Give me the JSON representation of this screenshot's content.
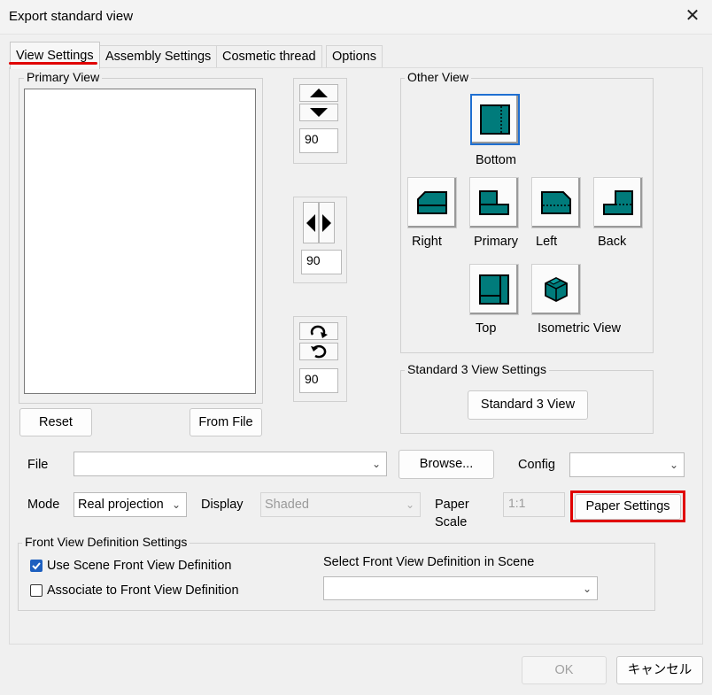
{
  "window": {
    "title": "Export standard view",
    "close_glyph": "✕"
  },
  "tabs": [
    {
      "label": "View Settings",
      "active": true
    },
    {
      "label": "Assembly Settings"
    },
    {
      "label": "Cosmetic thread"
    },
    {
      "label": "Options"
    }
  ],
  "primary_view": {
    "legend": "Primary View",
    "reset_label": "Reset",
    "from_file_label": "From File"
  },
  "rotation": {
    "vertical_value": "90",
    "horizontal_value": "90",
    "roll_value": "90"
  },
  "other_view": {
    "legend": "Other View",
    "bottom": "Bottom",
    "right": "Right",
    "primary": "Primary",
    "left": "Left",
    "back": "Back",
    "top": "Top",
    "isometric": "Isometric View"
  },
  "standard3": {
    "legend": "Standard 3 View Settings",
    "button_label": "Standard 3 View"
  },
  "file_row": {
    "file_label": "File",
    "file_value": "",
    "browse_label": "Browse...",
    "config_label": "Config",
    "config_value": ""
  },
  "mode_row": {
    "mode_label": "Mode",
    "mode_value": "Real projection",
    "display_label": "Display",
    "display_value": "Shaded",
    "paper_scale_label_1": "Paper",
    "paper_scale_label_2": "Scale",
    "paper_scale_value": "1:1",
    "paper_settings_label": "Paper Settings"
  },
  "front_view": {
    "legend": "Front View Definition Settings",
    "use_scene_label": "Use Scene Front View Definition",
    "use_scene_checked": true,
    "associate_label": "Associate to Front View Definition",
    "associate_checked": false,
    "select_label": "Select Front View Definition in Scene",
    "select_value": ""
  },
  "footer": {
    "ok_label": "OK",
    "cancel_label": "キャンセル"
  },
  "colors": {
    "icon_teal": "#007b7b",
    "highlight_red": "#e00000",
    "selected_blue": "#1f6fd1"
  }
}
